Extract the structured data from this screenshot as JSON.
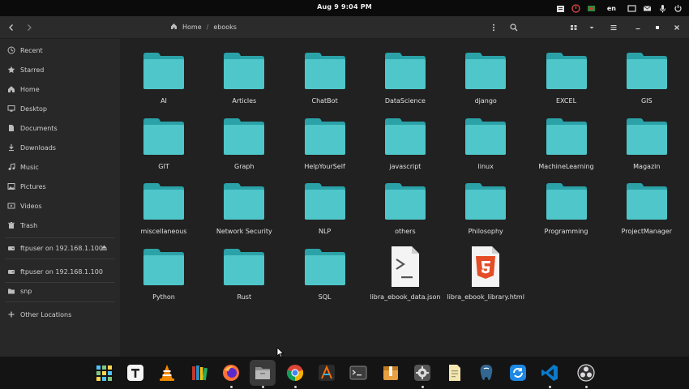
{
  "topbar": {
    "clock": "Aug 9   9:04 PM",
    "lang": "en"
  },
  "header": {
    "crumbs": [
      "Home",
      "ebooks"
    ]
  },
  "sidebar": {
    "items": [
      {
        "label": "Recent",
        "icon": "clock-icon"
      },
      {
        "label": "Starred",
        "icon": "star-icon"
      },
      {
        "label": "Home",
        "icon": "home-icon"
      },
      {
        "label": "Desktop",
        "icon": "desktop-icon"
      },
      {
        "label": "Documents",
        "icon": "document-icon"
      },
      {
        "label": "Downloads",
        "icon": "download-icon"
      },
      {
        "label": "Music",
        "icon": "music-icon"
      },
      {
        "label": "Pictures",
        "icon": "picture-icon"
      },
      {
        "label": "Videos",
        "icon": "video-icon"
      },
      {
        "label": "Trash",
        "icon": "trash-icon"
      },
      {
        "label": "ftpuser on 192.168.1.100",
        "icon": "network-drive-icon"
      },
      {
        "label": "ftpuser on 192.168.1.100",
        "icon": "network-drive-icon"
      },
      {
        "label": "snp",
        "icon": "folder-icon"
      },
      {
        "label": "Other Locations",
        "icon": "plus-icon"
      }
    ]
  },
  "files": [
    {
      "name": "AI",
      "kind": "folder"
    },
    {
      "name": "Articles",
      "kind": "folder"
    },
    {
      "name": "ChatBot",
      "kind": "folder"
    },
    {
      "name": "DataScience",
      "kind": "folder"
    },
    {
      "name": "django",
      "kind": "folder"
    },
    {
      "name": "EXCEL",
      "kind": "folder"
    },
    {
      "name": "GIS",
      "kind": "folder"
    },
    {
      "name": "GIT",
      "kind": "folder"
    },
    {
      "name": "Graph",
      "kind": "folder"
    },
    {
      "name": "HelpYourSelf",
      "kind": "folder"
    },
    {
      "name": "javascript",
      "kind": "folder"
    },
    {
      "name": "linux",
      "kind": "folder"
    },
    {
      "name": "MachineLearning",
      "kind": "folder"
    },
    {
      "name": "Magazin",
      "kind": "folder"
    },
    {
      "name": "miscellaneous",
      "kind": "folder"
    },
    {
      "name": "Network Security",
      "kind": "folder"
    },
    {
      "name": "NLP",
      "kind": "folder"
    },
    {
      "name": "others",
      "kind": "folder"
    },
    {
      "name": "Philosophy",
      "kind": "folder"
    },
    {
      "name": "Programming",
      "kind": "folder"
    },
    {
      "name": "ProjectManager",
      "kind": "folder"
    },
    {
      "name": "Python",
      "kind": "folder"
    },
    {
      "name": "Rust",
      "kind": "folder"
    },
    {
      "name": "SQL",
      "kind": "folder"
    },
    {
      "name": "libra_ebook_data.json",
      "kind": "json"
    },
    {
      "name": "libra_ebook_library.html",
      "kind": "html"
    }
  ],
  "dock": [
    {
      "name": "app-grid-icon",
      "running": false
    },
    {
      "name": "typora-icon",
      "running": false
    },
    {
      "name": "vlc-icon",
      "running": false
    },
    {
      "name": "bookshelf-icon",
      "running": false
    },
    {
      "name": "firefox-icon",
      "running": true
    },
    {
      "name": "files-icon",
      "running": true
    },
    {
      "name": "chrome-icon",
      "running": true
    },
    {
      "name": "text-editor-a-icon",
      "running": false
    },
    {
      "name": "terminal-icon",
      "running": false
    },
    {
      "name": "archive-manager-icon",
      "running": false
    },
    {
      "name": "settings-icon",
      "running": true
    },
    {
      "name": "notes-icon",
      "running": false
    },
    {
      "name": "pgadmin-icon",
      "running": false
    },
    {
      "name": "sync-icon",
      "running": false
    },
    {
      "name": "vscode-icon",
      "running": true
    },
    {
      "name": "obs-icon",
      "running": true
    }
  ],
  "colors": {
    "folder_back": "#2aa2a8",
    "folder_front": "#4fc6c9",
    "html5": "#e44d26"
  }
}
